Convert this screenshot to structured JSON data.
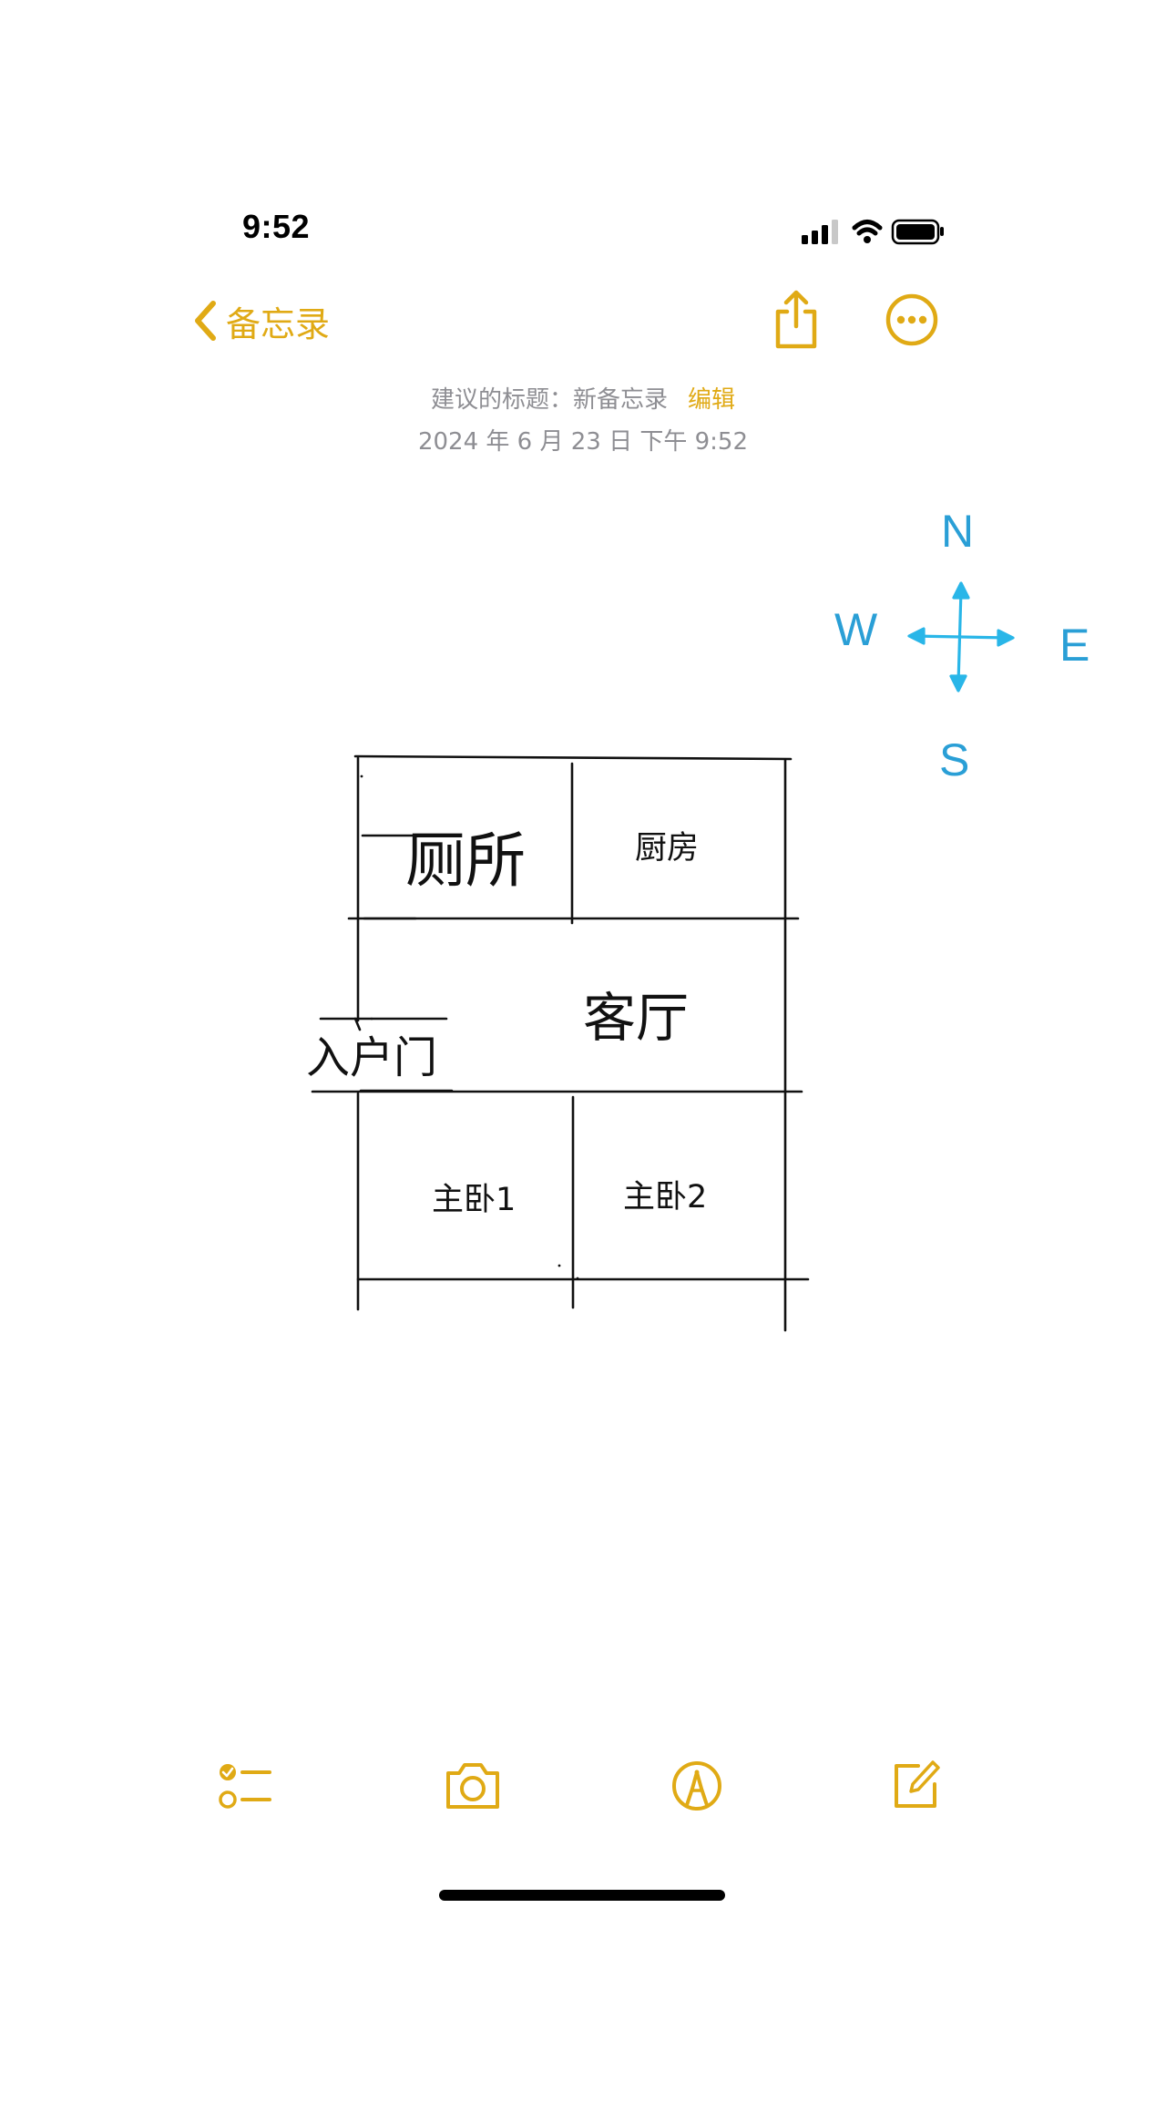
{
  "status_bar": {
    "time": "9:52",
    "icons": [
      "signal-icon",
      "wifi-icon",
      "battery-icon"
    ]
  },
  "nav": {
    "back_label": "备忘录",
    "back_icon": "chevron-left-icon",
    "share_icon": "share-icon",
    "more_icon": "ellipsis-circle-icon",
    "accent_color": "#e0aa15"
  },
  "note": {
    "suggested_title_text": "建议的标题：新备忘录",
    "edit_label": "编辑",
    "date": "2024 年 6 月 23 日 下午 9:52"
  },
  "drawing": {
    "rooms": {
      "toilet": "厕所",
      "kitchen": "厨房",
      "living_room": "客厅",
      "entrance": "入户门",
      "master_bedroom_1": "主卧1",
      "master_bedroom_2": "主卧2"
    },
    "compass": {
      "north": "N",
      "south": "S",
      "east": "E",
      "west": "W",
      "color": "#2a9fd6",
      "arrow_color": "#29b6e8"
    }
  },
  "toolbar": {
    "checklist_icon": "checklist-icon",
    "camera_icon": "camera-icon",
    "markup_icon": "pen-markup-icon",
    "compose_icon": "compose-icon"
  }
}
